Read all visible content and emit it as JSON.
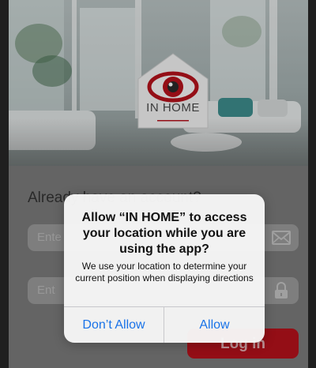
{
  "app": {
    "logo_text": "IN HOME"
  },
  "form": {
    "prompt_text": "Already have an account?",
    "email_placeholder": "Ente",
    "password_placeholder": "Ent",
    "email_icon": "envelope-icon",
    "password_icon": "lock-icon",
    "login_label": "Log in"
  },
  "alert": {
    "title": "Allow “IN HOME” to access your location while you are using the app?",
    "message": "We use your location to determine your current position when displaying directions",
    "deny_label": "Don’t Allow",
    "allow_label": "Allow"
  },
  "colors": {
    "brand_red": "#b5121b",
    "system_blue": "#1a73e8"
  }
}
